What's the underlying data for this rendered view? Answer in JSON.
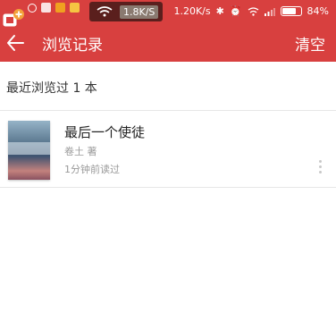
{
  "status_bar": {
    "speed": "1.8K/S",
    "net_speed": "1.20K/s",
    "battery": "84%",
    "battery_level": 0.84,
    "icons": [
      "app-icon",
      "app-icon",
      "app-icon",
      "app-icon",
      "wifi-icon",
      "bluetooth-icon",
      "alarm-icon",
      "wifi-icon",
      "signal-icon",
      "battery-icon"
    ]
  },
  "header": {
    "title": "浏览记录",
    "clear_label": "清空"
  },
  "section": {
    "title": "最近浏览过 1 本"
  },
  "books": [
    {
      "title": "最后一个使徒",
      "author": "卷土 著",
      "time": "1分钟前读过"
    }
  ],
  "colors": {
    "primary": "#d8403f"
  }
}
